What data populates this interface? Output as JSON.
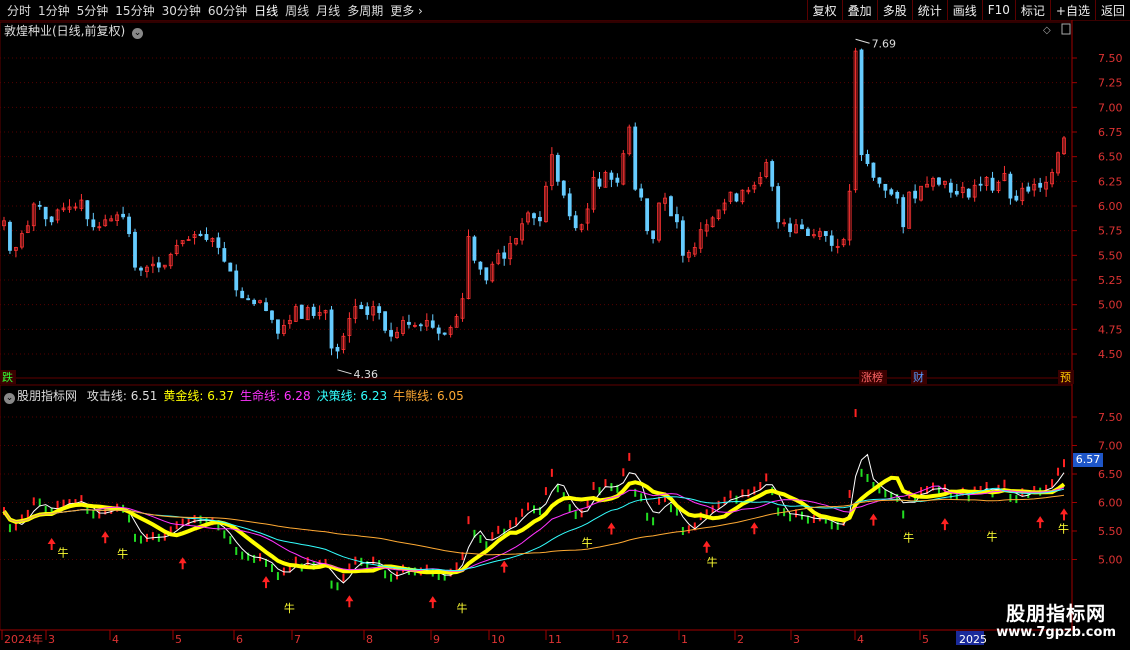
{
  "toolbar": {
    "periods": [
      "分时",
      "1分钟",
      "5分钟",
      "15分钟",
      "30分钟",
      "60分钟",
      "日线",
      "周线",
      "月线",
      "多周期",
      "更多"
    ],
    "active_period": "日线",
    "buttons": [
      "复权",
      "叠加",
      "多股",
      "统计",
      "画线",
      "F10",
      "标记",
      "+自选",
      "返回"
    ]
  },
  "chart_title": "敦煌种业(日线,前复权)",
  "indicator": {
    "name": "股朋指标网",
    "lines": [
      {
        "label": "攻击线:",
        "value": "6.51",
        "color": "#ffffff"
      },
      {
        "label": "黄金线:",
        "value": "6.37",
        "color": "#ffff00"
      },
      {
        "label": "生命线:",
        "value": "6.28",
        "color": "#ff33ff"
      },
      {
        "label": "决策线:",
        "value": "6.23",
        "color": "#33ffff"
      },
      {
        "label": "牛熊线:",
        "value": "6.05",
        "color": "#ffaa33"
      }
    ],
    "current_price": "6.57",
    "bull_char": "牛"
  },
  "price_high_label": "7.69",
  "price_low_label": "4.36",
  "events": [
    {
      "text": "跌",
      "color": "#33ff33"
    },
    {
      "text": "涨榜",
      "color": "#ff6666"
    },
    {
      "text": "财",
      "color": "#5599ff"
    },
    {
      "text": "预",
      "color": "#ffcc00"
    }
  ],
  "colors": {
    "up": "#ff3333",
    "down": "#66ccff",
    "grid": "#550000",
    "axis_text": "#dd3333"
  },
  "watermark": {
    "line1": "股朋指标网",
    "line2": "www.7gpzb.com"
  },
  "chart_data": {
    "type": "candlestick",
    "price_axis": {
      "ticks": [
        4.5,
        4.75,
        5.0,
        5.25,
        5.5,
        5.75,
        6.0,
        6.25,
        6.5,
        6.75,
        7.0,
        7.25,
        7.5
      ],
      "range": [
        4.33,
        7.83
      ]
    },
    "indicator_axis": {
      "ticks": [
        5.0,
        5.5,
        6.0,
        6.5,
        7.0,
        7.5
      ],
      "range": [
        4.5,
        7.9
      ]
    },
    "x_labels": [
      "2024年",
      "3",
      "4",
      "5",
      "6",
      "7",
      "8",
      "9",
      "10",
      "11",
      "12",
      "1",
      "2",
      "3",
      "4",
      "5",
      "2025"
    ],
    "closes": [
      5.85,
      5.55,
      5.58,
      5.72,
      5.8,
      6.02,
      6.0,
      5.87,
      5.84,
      5.96,
      5.98,
      5.99,
      5.99,
      6.06,
      5.87,
      5.79,
      5.79,
      5.86,
      5.87,
      5.91,
      5.89,
      5.72,
      5.38,
      5.35,
      5.38,
      5.41,
      5.38,
      5.4,
      5.51,
      5.6,
      5.65,
      5.66,
      5.71,
      5.7,
      5.66,
      5.67,
      5.58,
      5.44,
      5.34,
      5.15,
      5.07,
      5.05,
      5.01,
      5.04,
      4.94,
      4.85,
      4.71,
      4.79,
      4.84,
      4.98,
      4.86,
      4.97,
      4.89,
      4.92,
      4.94,
      4.56,
      4.53,
      4.68,
      4.86,
      4.98,
      4.96,
      4.9,
      4.98,
      4.92,
      4.74,
      4.68,
      4.72,
      4.84,
      4.8,
      4.79,
      4.79,
      4.84,
      4.77,
      4.71,
      4.7,
      4.77,
      4.88,
      5.06,
      5.69,
      5.45,
      5.36,
      5.25,
      5.41,
      5.52,
      5.47,
      5.62,
      5.67,
      5.82,
      5.93,
      5.88,
      5.85,
      6.2,
      6.52,
      6.25,
      6.11,
      5.9,
      5.78,
      5.81,
      5.97,
      6.29,
      6.2,
      6.34,
      6.27,
      6.24,
      6.53,
      6.8,
      6.17,
      6.09,
      5.75,
      5.67,
      6.03,
      6.08,
      5.9,
      5.84,
      5.5,
      5.53,
      5.58,
      5.76,
      5.81,
      5.88,
      5.96,
      6.03,
      6.14,
      6.05,
      6.16,
      6.16,
      6.21,
      6.29,
      6.44,
      6.2,
      5.84,
      5.83,
      5.74,
      5.81,
      5.77,
      5.7,
      5.71,
      5.74,
      5.7,
      5.6,
      5.59,
      5.66,
      6.15,
      7.57,
      6.52,
      6.43,
      6.29,
      6.23,
      6.16,
      6.12,
      6.08,
      5.79,
      6.14,
      6.08,
      6.2,
      6.22,
      6.28,
      6.22,
      6.25,
      6.14,
      6.12,
      6.19,
      6.09,
      6.21,
      6.22,
      6.29,
      6.16,
      6.24,
      6.33,
      6.08,
      6.06,
      6.18,
      6.15,
      6.22,
      6.19,
      6.24,
      6.34,
      6.54,
      6.69
    ]
  }
}
